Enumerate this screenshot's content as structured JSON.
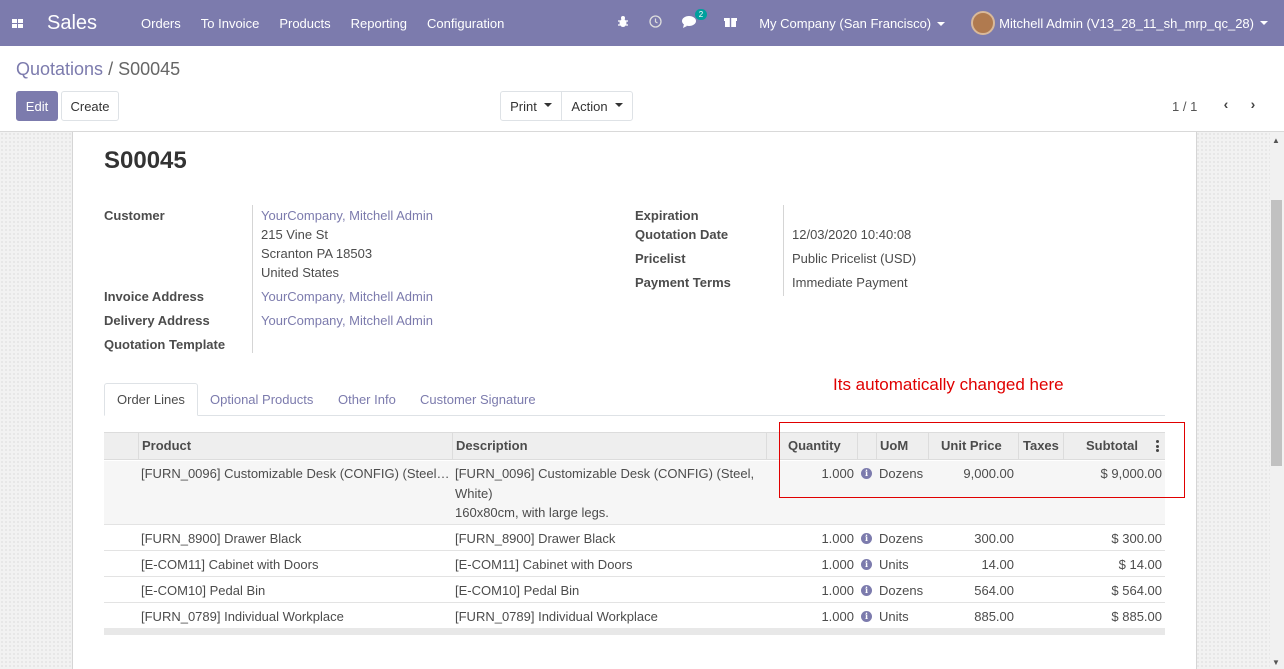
{
  "navbar": {
    "app_name": "Sales",
    "menu": [
      "Orders",
      "To Invoice",
      "Products",
      "Reporting",
      "Configuration"
    ],
    "messages_count": "2",
    "company": "My Company (San Francisco)",
    "user": "Mitchell Admin (V13_28_11_sh_mrp_qc_28)"
  },
  "control_panel": {
    "breadcrumb_parent": "Quotations",
    "breadcrumb_sep": "/",
    "breadcrumb_current": "S00045",
    "edit_label": "Edit",
    "create_label": "Create",
    "print_label": "Print",
    "action_label": "Action",
    "pager": "1 / 1"
  },
  "record": {
    "name": "S00045",
    "labels": {
      "customer": "Customer",
      "invoice_address": "Invoice Address",
      "delivery_address": "Delivery Address",
      "quotation_template": "Quotation Template",
      "expiration": "Expiration",
      "quotation_date": "Quotation Date",
      "pricelist": "Pricelist",
      "payment_terms": "Payment Terms"
    },
    "customer_name": "YourCompany, Mitchell Admin",
    "customer_address": [
      "215 Vine St",
      "Scranton PA 18503",
      "United States"
    ],
    "invoice_address": "YourCompany, Mitchell Admin",
    "delivery_address": "YourCompany, Mitchell Admin",
    "quotation_date": "12/03/2020 10:40:08",
    "pricelist": "Public Pricelist (USD)",
    "payment_terms": "Immediate Payment"
  },
  "tabs": [
    "Order Lines",
    "Optional Products",
    "Other Info",
    "Customer Signature"
  ],
  "annotation": "Its automatically changed here",
  "table": {
    "headers": {
      "product": "Product",
      "description": "Description",
      "quantity": "Quantity",
      "uom": "UoM",
      "unit_price": "Unit Price",
      "taxes": "Taxes",
      "subtotal": "Subtotal"
    },
    "rows": [
      {
        "product": "[FURN_0096] Customizable Desk (CONFIG) (Steel…",
        "description": [
          "[FURN_0096] Customizable Desk (CONFIG) (Steel,",
          "White)",
          "160x80cm, with large legs."
        ],
        "quantity": "1.000",
        "uom": "Dozens",
        "unit_price": "9,000.00",
        "taxes": "",
        "subtotal": "$ 9,000.00"
      },
      {
        "product": "[FURN_8900] Drawer Black",
        "description": [
          "[FURN_8900] Drawer Black"
        ],
        "quantity": "1.000",
        "uom": "Dozens",
        "unit_price": "300.00",
        "taxes": "",
        "subtotal": "$ 300.00"
      },
      {
        "product": "[E-COM11] Cabinet with Doors",
        "description": [
          "[E-COM11] Cabinet with Doors"
        ],
        "quantity": "1.000",
        "uom": "Units",
        "unit_price": "14.00",
        "taxes": "",
        "subtotal": "$ 14.00"
      },
      {
        "product": "[E-COM10] Pedal Bin",
        "description": [
          "[E-COM10] Pedal Bin"
        ],
        "quantity": "1.000",
        "uom": "Dozens",
        "unit_price": "564.00",
        "taxes": "",
        "subtotal": "$ 564.00"
      },
      {
        "product": "[FURN_0789] Individual Workplace",
        "description": [
          "[FURN_0789] Individual Workplace"
        ],
        "quantity": "1.000",
        "uom": "Units",
        "unit_price": "885.00",
        "taxes": "",
        "subtotal": "$ 885.00"
      }
    ]
  }
}
